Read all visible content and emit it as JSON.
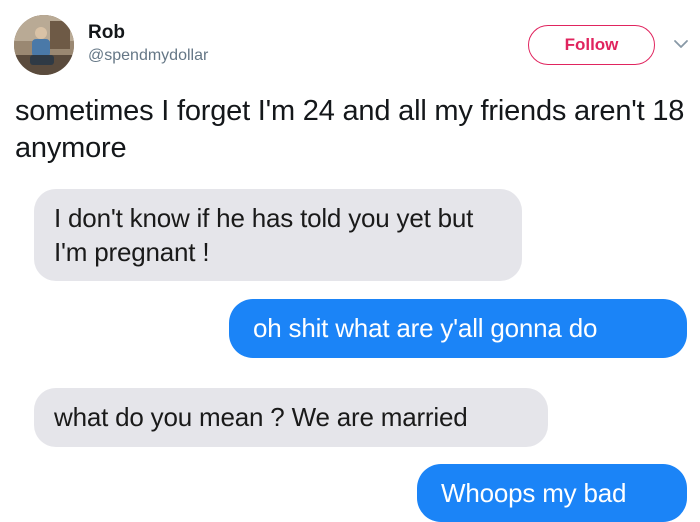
{
  "tweet": {
    "author_name": "Rob",
    "author_handle": "@spendmydollar",
    "follow_label": "Follow",
    "text": "sometimes I forget I'm 24 and all my friends aren't 18 anymore"
  },
  "messages": [
    {
      "direction": "incoming",
      "text": "I don't know if he has told you yet but I'm pregnant !"
    },
    {
      "direction": "outgoing",
      "text": "oh shit what are y'all gonna do"
    },
    {
      "direction": "incoming",
      "text": "what do you mean ? We are married"
    },
    {
      "direction": "outgoing",
      "text": "Whoops my bad"
    }
  ],
  "colors": {
    "follow_accent": "#e0245e",
    "outgoing_bubble": "#1b84f7",
    "incoming_bubble": "#e5e5ea",
    "handle_gray": "#657786"
  },
  "icons": {
    "menu": "chevron-down-icon"
  }
}
